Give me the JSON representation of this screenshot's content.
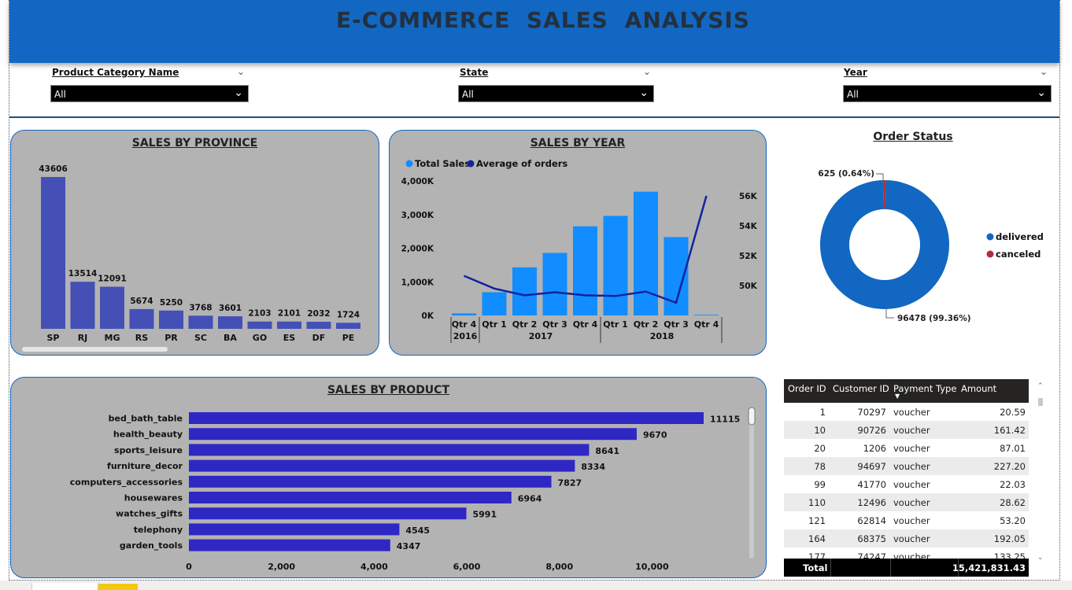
{
  "header": {
    "title": "E-COMMERCE  SALES  ANALYSIS"
  },
  "slicers": [
    {
      "label": "Product Category Name",
      "value": "All"
    },
    {
      "label": "State",
      "value": "All"
    },
    {
      "label": "Year",
      "value": "All"
    }
  ],
  "province_chart": {
    "title": "SALES BY PROVINCE"
  },
  "year_chart": {
    "title": "SALES BY YEAR",
    "legend": [
      "Total Sales",
      "Average of orders"
    ],
    "left_ticks": [
      "4,000K",
      "3,000K",
      "2,000K",
      "1,000K",
      "0K"
    ],
    "right_ticks": [
      "56K",
      "54K",
      "52K",
      "50K"
    ],
    "year_labels": [
      "2016",
      "2017",
      "2018"
    ]
  },
  "order_status": {
    "title": "Order Status",
    "canceled_label": "625 (0.64%)",
    "delivered_label": "96478 (99.36%)",
    "legend": [
      "delivered",
      "canceled"
    ]
  },
  "product_chart": {
    "title": "SALES BY PRODUCT"
  },
  "table": {
    "columns": [
      "Order ID",
      "Customer ID",
      "Payment Type",
      "Amount"
    ],
    "rows": [
      [
        "1",
        "70297",
        "voucher",
        "20.59"
      ],
      [
        "10",
        "90726",
        "voucher",
        "161.42"
      ],
      [
        "20",
        "1206",
        "voucher",
        "87.01"
      ],
      [
        "78",
        "94697",
        "voucher",
        "227.20"
      ],
      [
        "99",
        "41770",
        "voucher",
        "22.03"
      ],
      [
        "110",
        "12496",
        "voucher",
        "28.62"
      ],
      [
        "121",
        "62814",
        "voucher",
        "53.20"
      ],
      [
        "164",
        "68375",
        "voucher",
        "192.05"
      ],
      [
        "177",
        "74247",
        "voucher",
        "133.25"
      ]
    ],
    "total_label": "Total",
    "total_value": "15,421,831.43"
  },
  "colors": {
    "header": "#1167c1",
    "province_bar": "#4450b5",
    "sales_bar": "#118dff",
    "avg_line": "#12239e",
    "product_bar": "#2f27c4",
    "delivered": "#1167c1",
    "canceled": "#b0303a"
  },
  "chart_data": [
    {
      "type": "bar",
      "title": "SALES BY PROVINCE",
      "categories": [
        "SP",
        "RJ",
        "MG",
        "RS",
        "PR",
        "SC",
        "BA",
        "GO",
        "ES",
        "DF",
        "PE"
      ],
      "values": [
        43606,
        13514,
        12091,
        5674,
        5250,
        3768,
        3601,
        2103,
        2101,
        2032,
        1724
      ],
      "ylim": [
        0,
        45000
      ]
    },
    {
      "type": "bar",
      "title": "SALES BY YEAR",
      "categories": [
        "Qtr 4",
        "Qtr 1",
        "Qtr 2",
        "Qtr 3",
        "Qtr 4",
        "Qtr 1",
        "Qtr 2",
        "Qtr 3",
        "Qtr 4"
      ],
      "years": [
        "2016",
        "2017",
        "2017",
        "2017",
        "2017",
        "2018",
        "2018",
        "2018",
        "2018"
      ],
      "series": [
        {
          "name": "Total Sales",
          "type": "bar",
          "axis": "left",
          "values": [
            60,
            690,
            1430,
            1860,
            2650,
            2960,
            3680,
            2330,
            20
          ]
        },
        {
          "name": "Average of orders",
          "type": "line",
          "axis": "right",
          "values": [
            50650,
            49800,
            49350,
            49550,
            49350,
            49300,
            49600,
            48850,
            56000
          ]
        }
      ],
      "ylim_left": [
        0,
        4000
      ],
      "ylim_right": [
        48000,
        57000
      ]
    },
    {
      "type": "pie",
      "title": "Order Status",
      "categories": [
        "delivered",
        "canceled"
      ],
      "values": [
        96478,
        625
      ]
    },
    {
      "type": "bar",
      "orientation": "horizontal",
      "title": "SALES BY PRODUCT",
      "categories": [
        "bed_bath_table",
        "health_beauty",
        "sports_leisure",
        "furniture_decor",
        "computers_accessories",
        "housewares",
        "watches_gifts",
        "telephony",
        "garden_tools"
      ],
      "values": [
        11115,
        9670,
        8641,
        8334,
        7827,
        6964,
        5991,
        4545,
        4347
      ],
      "x_ticks": [
        "0",
        "2,000",
        "4,000",
        "6,000",
        "8,000",
        "10,000"
      ],
      "xlim": [
        0,
        11115
      ]
    }
  ]
}
